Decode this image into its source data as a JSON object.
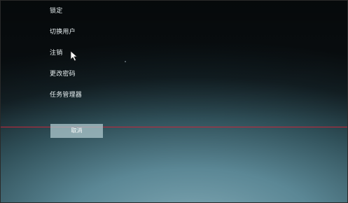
{
  "menu": {
    "items": [
      {
        "label": "锁定"
      },
      {
        "label": "切换用户"
      },
      {
        "label": "注销"
      },
      {
        "label": "更改密码"
      },
      {
        "label": "任务管理器"
      }
    ]
  },
  "cancel": {
    "label": "取消"
  },
  "colors": {
    "accent_line": "#c4263a",
    "text": "#e6eef0",
    "button_bg": "#afc8cd"
  }
}
